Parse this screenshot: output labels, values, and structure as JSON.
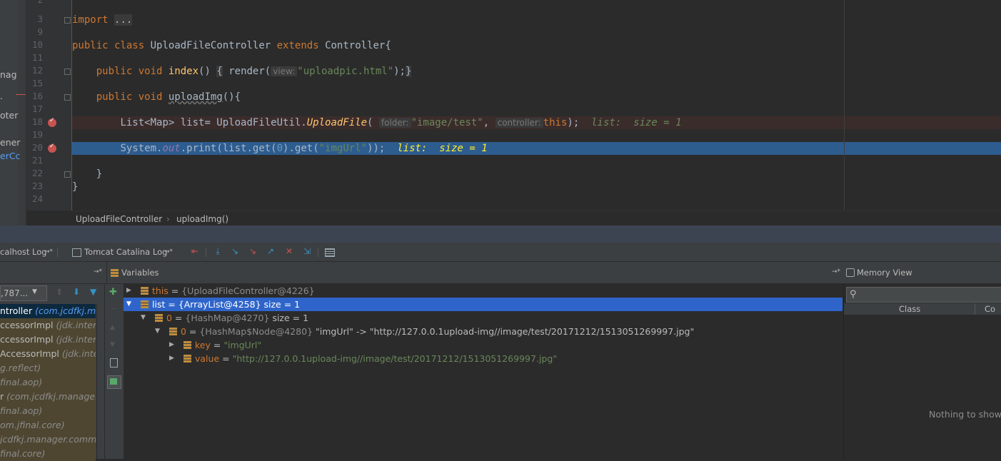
{
  "project_panel": {
    "items": [
      "nag",
      ".",
      "oter",
      "ener",
      "erCc"
    ]
  },
  "gutter": {
    "line_numbers": [
      "2",
      "3",
      "9",
      "10",
      "11",
      "12",
      "15",
      "16",
      "17",
      "18",
      "19",
      "20",
      "21",
      "22",
      "23",
      "24"
    ]
  },
  "code": {
    "l3_import": "import",
    "l3_fold": "...",
    "l10_public": "public",
    "l10_class": "class",
    "l10_name": "UploadFileController",
    "l10_extends": "extends",
    "l10_super": "Controller{",
    "l12_public": "public",
    "l12_void": "void",
    "l12_fn": "index",
    "l12_paren": "()",
    "l12_open": "{",
    "l12_render": "render(",
    "l12_hint": "view:",
    "l12_str": "\"uploadpic.html\"",
    "l12_end": ");",
    "l12_close": "}",
    "l16_public": "public",
    "l16_void": "void",
    "l16_fn": "uploadImg",
    "l16_rest": "(){",
    "l18_decl": "List<Map> list= UploadFileUtil.",
    "l18_method": "UploadFile",
    "l18_open": "(",
    "l18_hint1": "folder:",
    "l18_str": "\"image/test\"",
    "l18_comma": ",",
    "l18_hint2": "controller:",
    "l18_this": "this",
    "l18_end": ");",
    "l18_inline_name": "list:",
    "l18_inline_val": "size = 1",
    "l20_sys": "System.",
    "l20_out": "out",
    "l20_print": ".print(list.get(",
    "l20_zero": "0",
    "l20_get": ").get(",
    "l20_str": "\"imgUrl\"",
    "l20_end": "));",
    "l20_inline_name": "list:",
    "l20_inline_val": "size = 1",
    "l22_close": "}",
    "l23_close": "}"
  },
  "breadcrumb": {
    "class": "UploadFileController",
    "sep": "›",
    "method": "uploadImg()"
  },
  "tabs": {
    "localhost": "calhost Log",
    "localhost_pin": "→*",
    "catalina": "Tomcat Catalina Log",
    "catalina_pin": "→*"
  },
  "frames": {
    "thread_select": ",787...",
    "items": [
      {
        "name": "ntroller",
        "pkg": "(com.jcdfkj.ma",
        "lib": false,
        "selected": true
      },
      {
        "name": "ccessorImpl",
        "pkg": "(jdk.interna",
        "lib": true
      },
      {
        "name": "ccessorImpl",
        "pkg": "(jdk.interna",
        "lib": true
      },
      {
        "name": "AccessorImpl",
        "pkg": "(jdk.inte",
        "lib": true
      },
      {
        "name": "",
        "pkg": "g.reflect)",
        "lib": true
      },
      {
        "name": "",
        "pkg": "final.aop)",
        "lib": true
      },
      {
        "name": "r",
        "pkg": "(com.jcdfkj.manager",
        "lib": true
      },
      {
        "name": "",
        "pkg": "final.aop)",
        "lib": true
      },
      {
        "name": "",
        "pkg": "om.jfinal.core)",
        "lib": true
      },
      {
        "name": "",
        "pkg": "jcdfkj.manager.commo",
        "lib": true
      },
      {
        "name": "",
        "pkg": "final.core)",
        "lib": true
      }
    ]
  },
  "variables": {
    "header_pin": "→*",
    "title": "Variables",
    "rows": [
      {
        "name": "this",
        "eq": " = ",
        "value": "{UploadFileController@4226}"
      },
      {
        "name": "list",
        "eq": " = ",
        "value": "{ArrayList@4258}",
        "extra": "  size = 1"
      },
      {
        "name": "0",
        "eq": " = ",
        "value": "{HashMap@4270}",
        "extra": "  size = 1"
      },
      {
        "name": "0",
        "eq": " = ",
        "value": "{HashMap$Node@4280}",
        "extra": " \"imgUrl\" -> \"http://127.0.0.1upload-img//image/test/20171212/1513051269997.jpg\""
      },
      {
        "name": "key",
        "eq": " = ",
        "value": "\"imgUrl\""
      },
      {
        "name": "value",
        "eq": " = ",
        "value": "\"http://127.0.0.1upload-img//image/test/20171212/1513051269997.jpg\""
      }
    ]
  },
  "memory": {
    "header_pin": "→*",
    "title": "Memory View",
    "col_class": "Class",
    "col_count": "Co",
    "empty": "Nothing to show"
  },
  "colors": {
    "editor_bg": "#2b2b2b",
    "selection": "#2d5c8f",
    "tree_selection": "#2f65ca",
    "breakpoint": "#c75450",
    "keyword": "#cc7832"
  }
}
